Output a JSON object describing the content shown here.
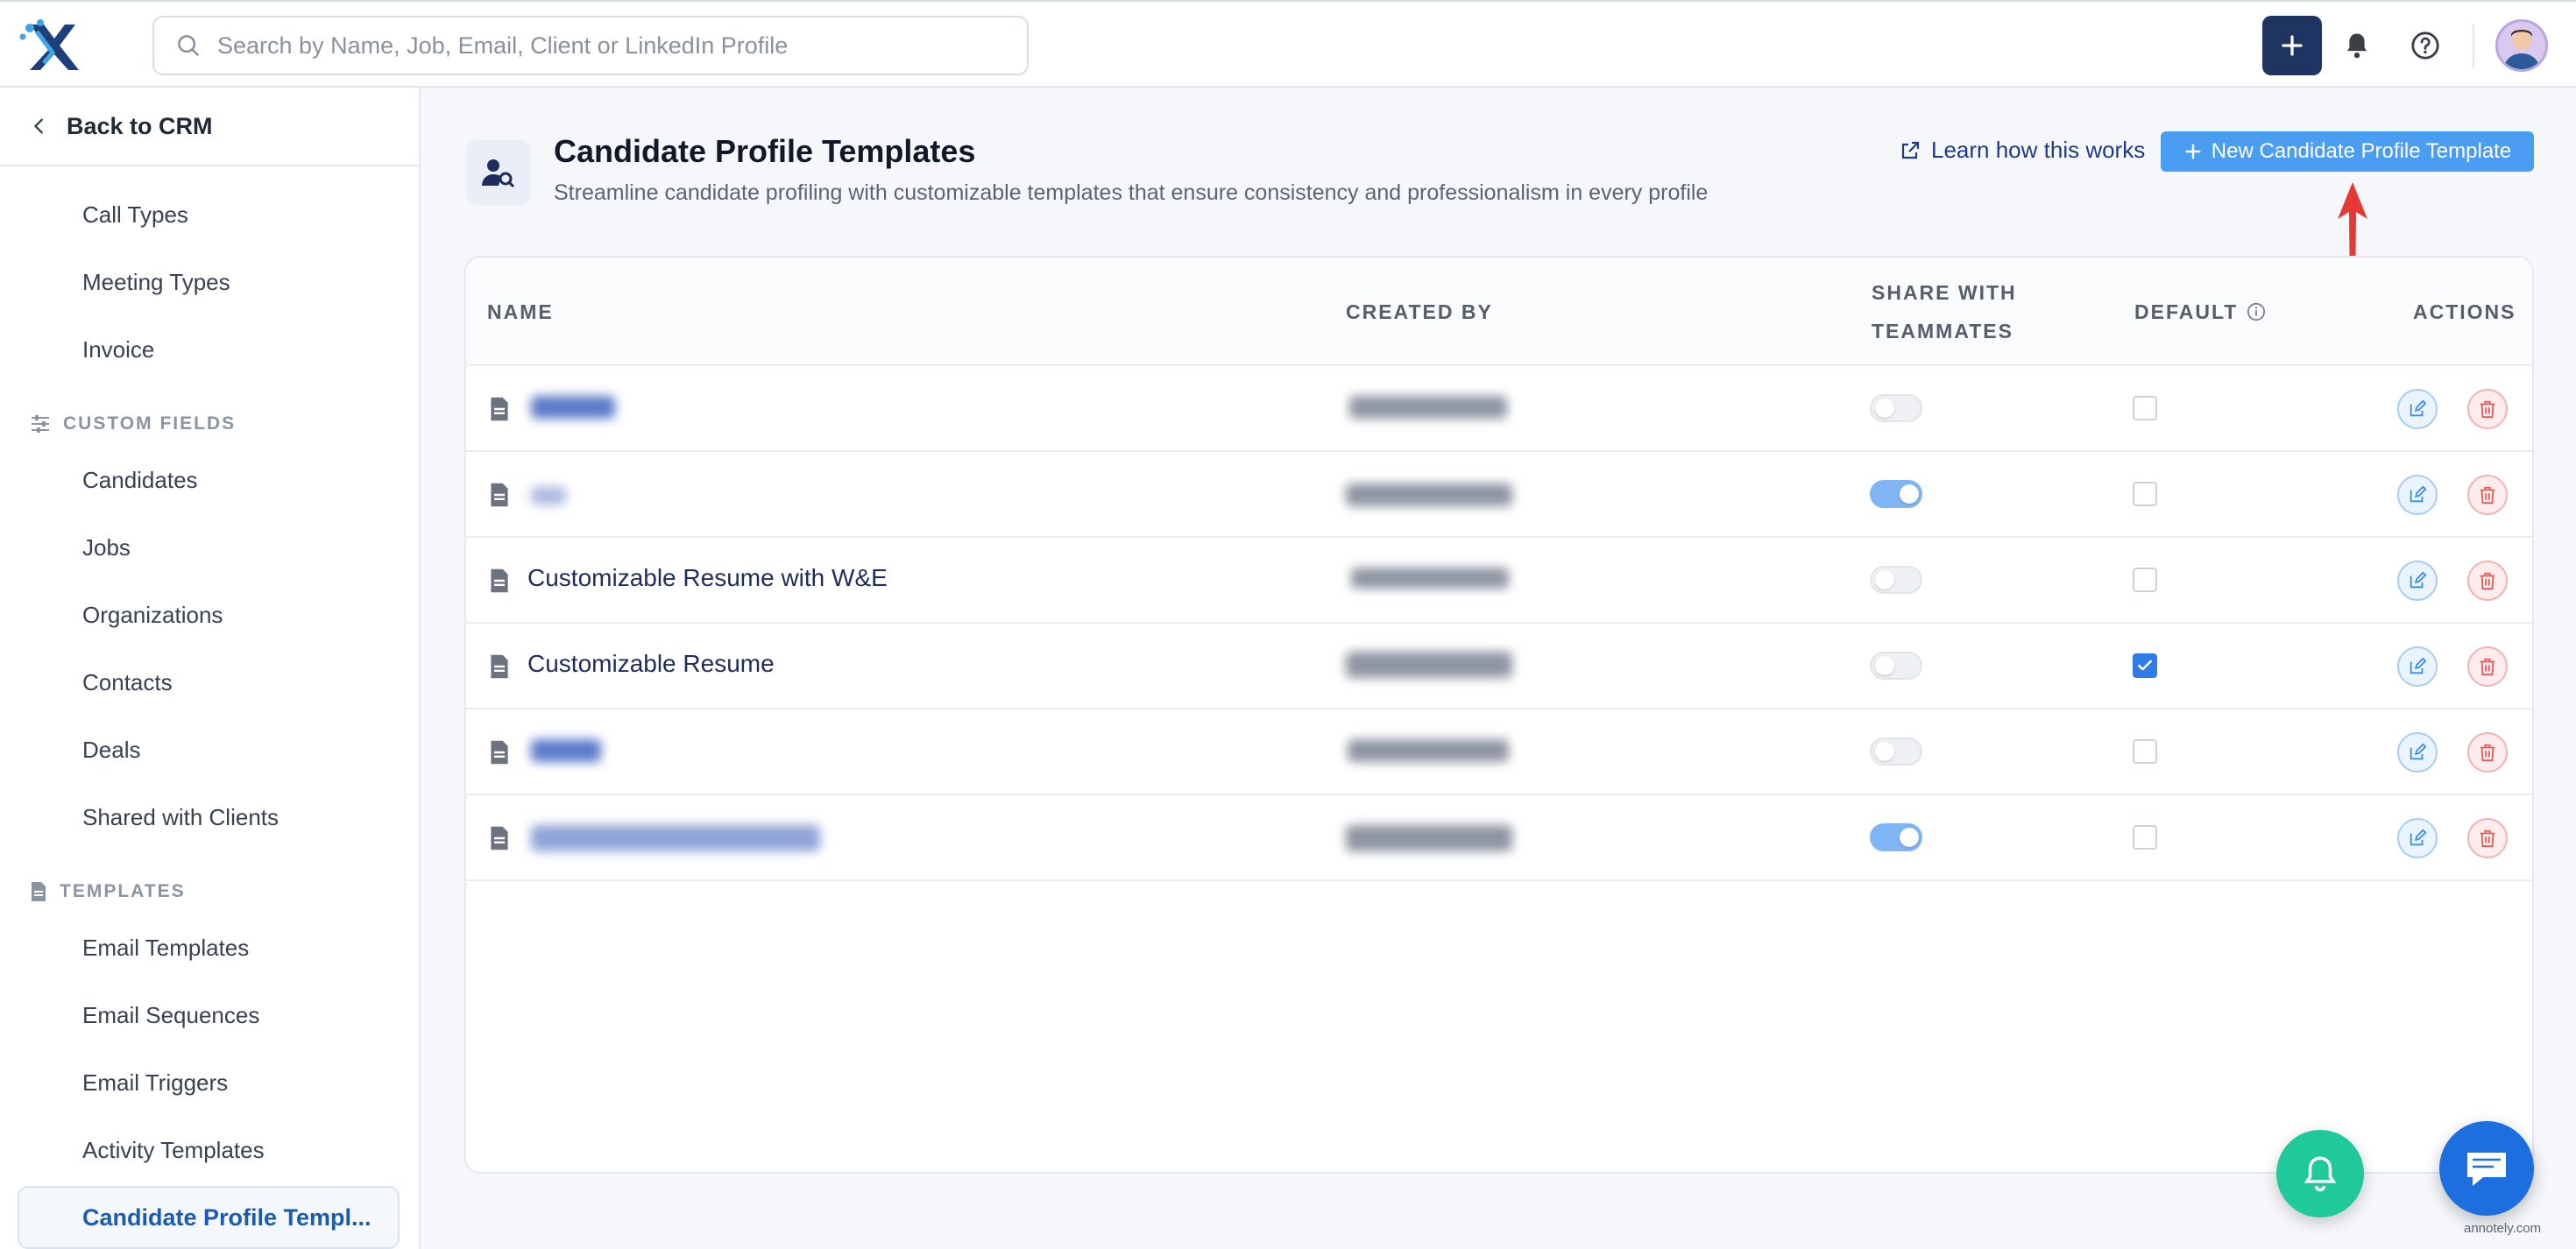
{
  "topbar": {
    "search_placeholder": "Search by Name, Job, Email, Client or LinkedIn Profile"
  },
  "sidebar": {
    "back_label": "Back to CRM",
    "items_top": [
      "Call Types",
      "Meeting Types",
      "Invoice"
    ],
    "custom_fields_header": "CUSTOM FIELDS",
    "custom_fields": [
      "Candidates",
      "Jobs",
      "Organizations",
      "Contacts",
      "Deals",
      "Shared with Clients"
    ],
    "templates_header": "TEMPLATES",
    "templates": [
      "Email Templates",
      "Email Sequences",
      "Email Triggers",
      "Activity Templates"
    ],
    "active_item": "Candidate Profile Templ..."
  },
  "page": {
    "title": "Candidate Profile Templates",
    "subtitle": "Streamline candidate profiling with customizable templates that ensure consistency and professionalism in every profile",
    "learn_link": "Learn how this works",
    "new_button": "New Candidate Profile Template"
  },
  "table": {
    "headers": {
      "name": "NAME",
      "created_by": "CREATED BY",
      "share_line1": "SHARE WITH",
      "share_line2": "TEAMMATES",
      "default": "DEFAULT",
      "actions": "ACTIONS"
    },
    "rows": [
      {
        "name": "",
        "shared": false,
        "default": false
      },
      {
        "name": "",
        "shared": true,
        "default": false
      },
      {
        "name": "Customizable Resume with W&E",
        "shared": false,
        "default": false
      },
      {
        "name": "Customizable Resume",
        "shared": false,
        "default": true
      },
      {
        "name": "",
        "shared": false,
        "default": false
      },
      {
        "name": "",
        "shared": true,
        "default": false
      }
    ]
  },
  "watermark": "annotely.com",
  "colors": {
    "primary_button": "#4a9df0",
    "add_button": "#1e3461",
    "active_nav_text": "#1c5bb0",
    "fab_bell": "#1fc99a",
    "fab_chat": "#1d6fe0",
    "annotation_arrow": "#e53935"
  }
}
